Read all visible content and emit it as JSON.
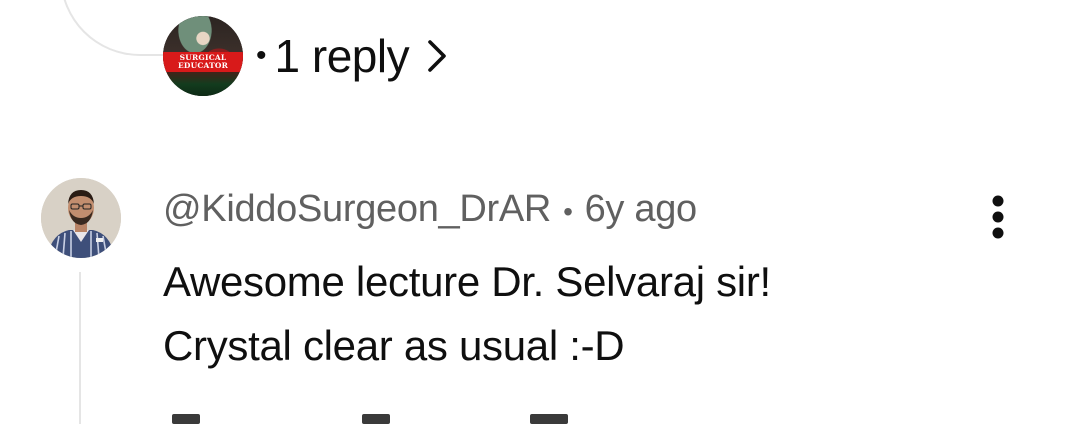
{
  "reply_summary": {
    "avatar_banner_line1": "SURGICAL",
    "avatar_banner_line2": "EDUCATOR",
    "separator": "•",
    "label": "1 reply"
  },
  "comment": {
    "author": "@KiddoSurgeon_DrAR",
    "separator": "•",
    "timestamp": "6y ago",
    "text_line1": "Awesome lecture Dr. Selvaraj sir!",
    "text_line2": "Crystal clear as usual :-D"
  },
  "icons": {
    "reply_expand": "chevron-right-icon",
    "more_actions": "more-vertical-icon"
  },
  "colors": {
    "primary_text": "#0f0f0f",
    "secondary_text": "#606060",
    "thread_line": "#e5e5e5",
    "banner_red": "#d81a1a"
  }
}
